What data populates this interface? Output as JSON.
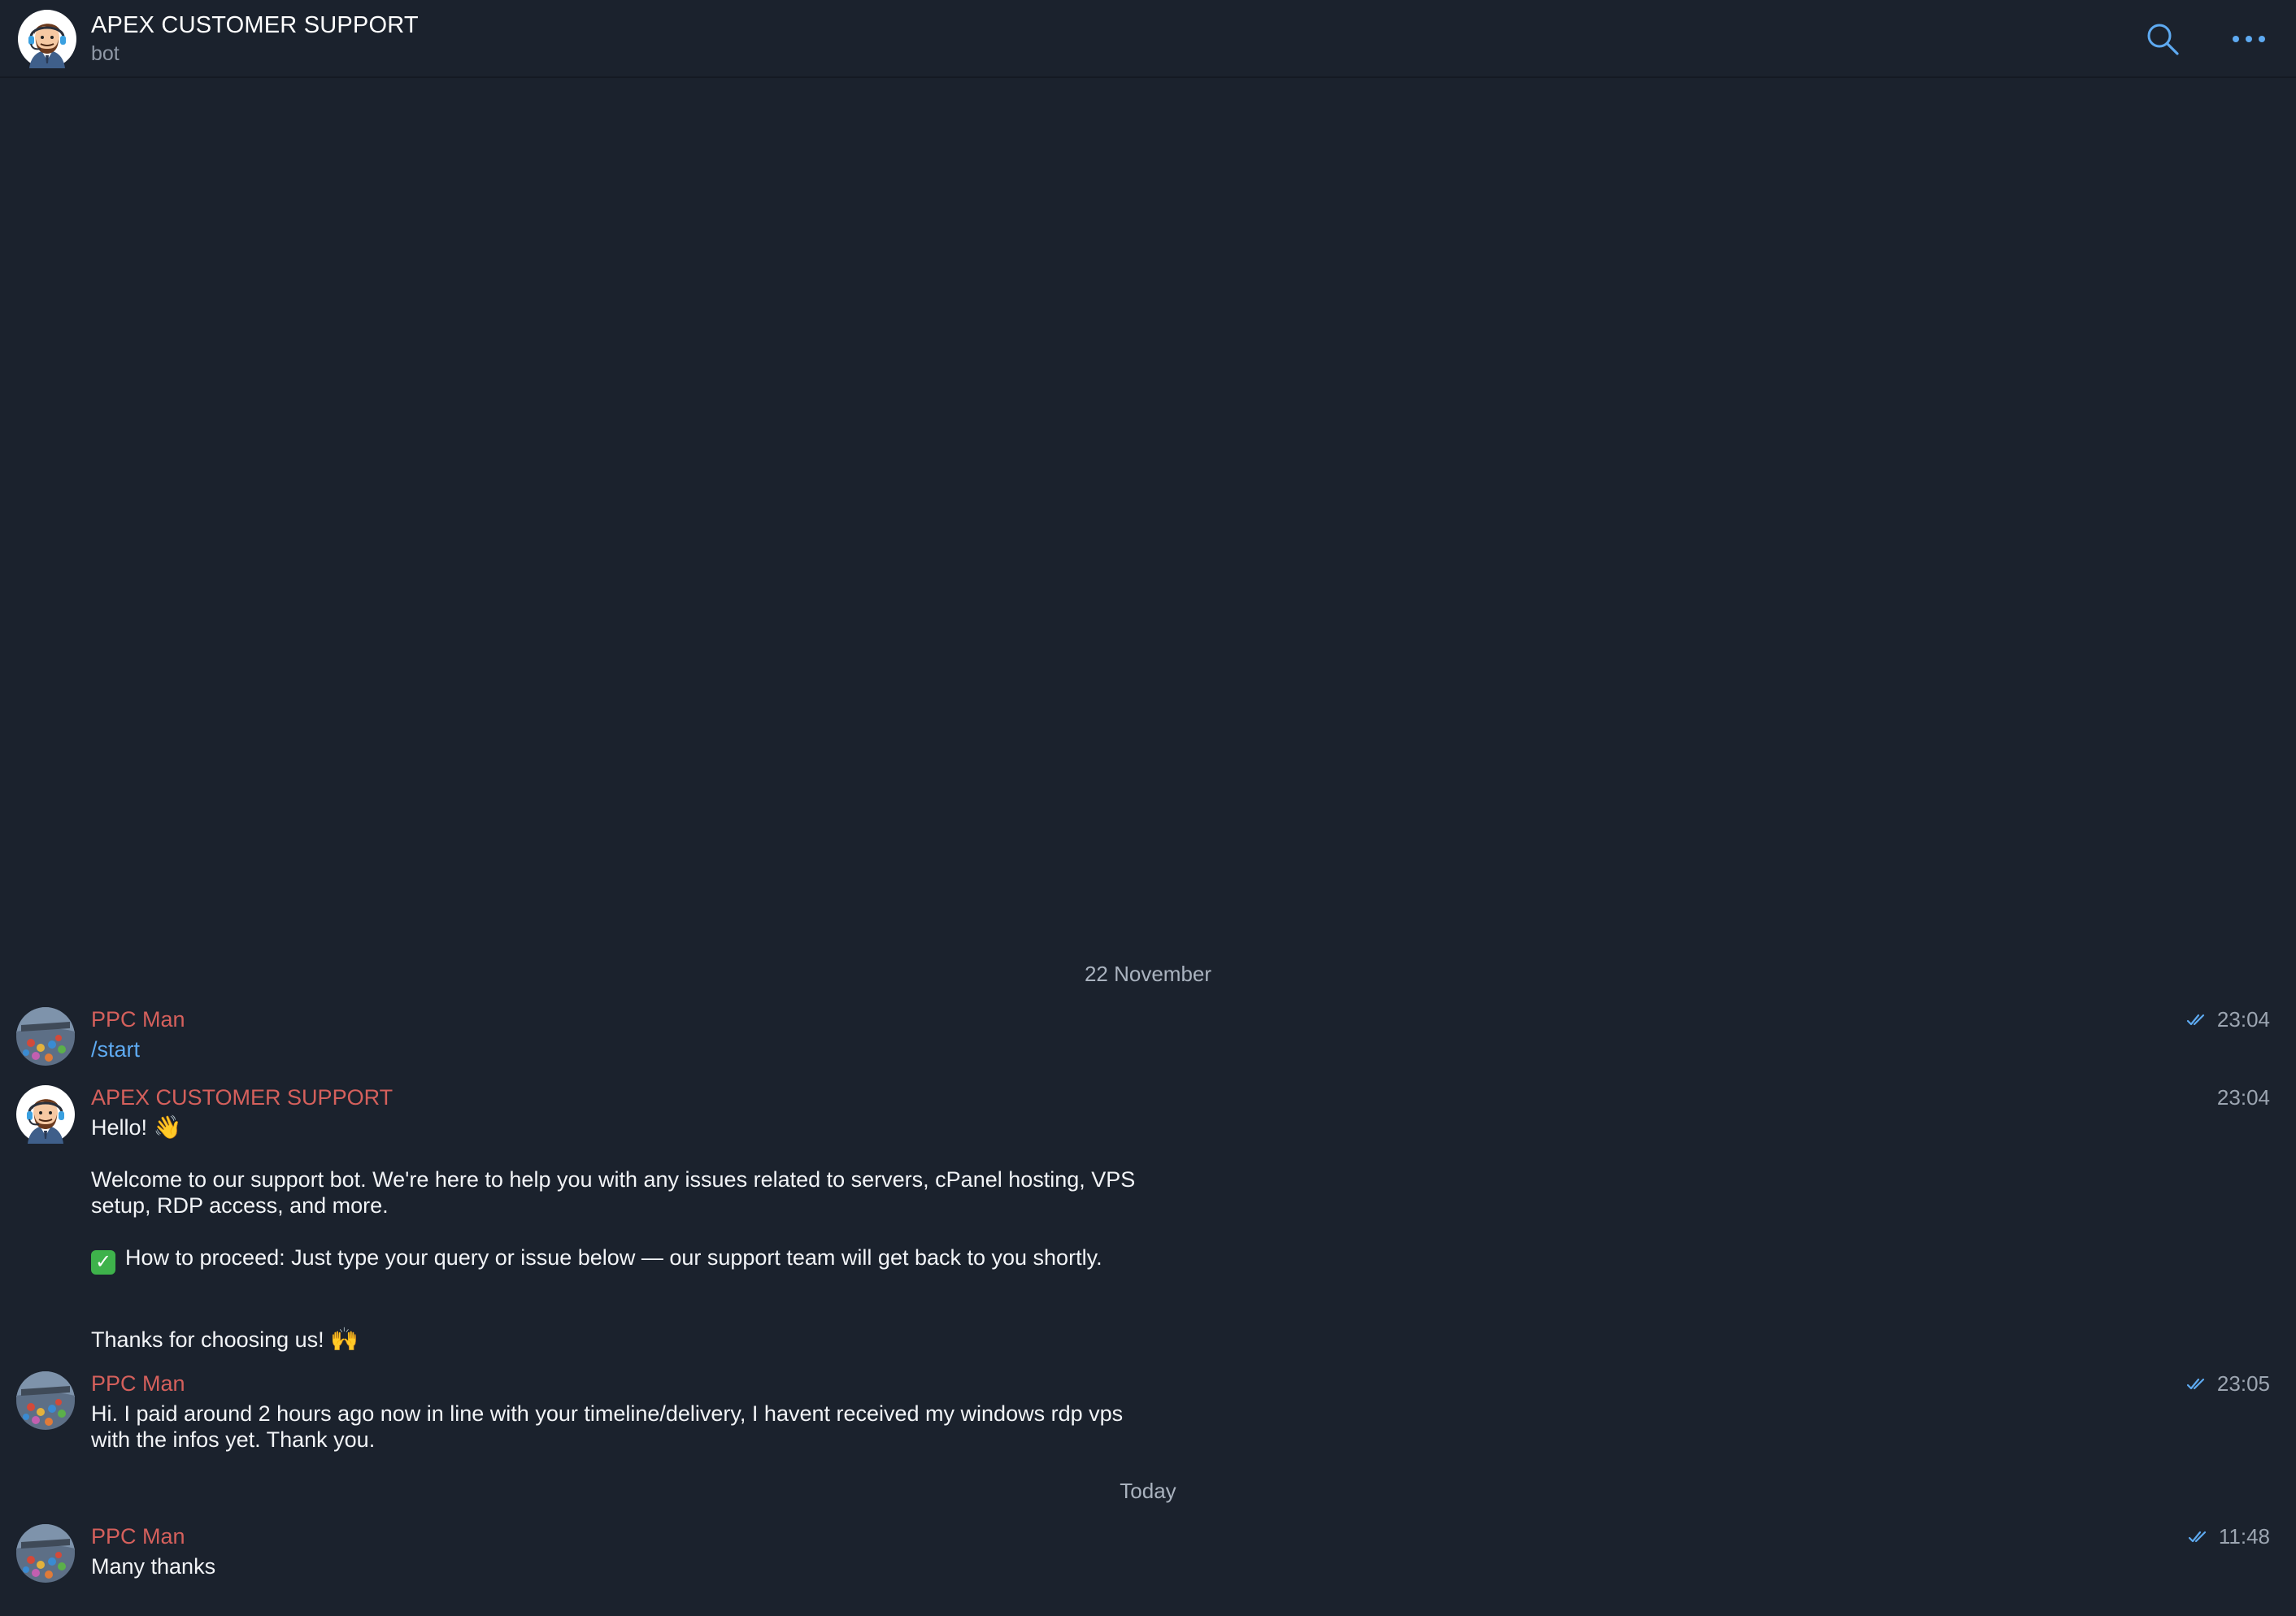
{
  "header": {
    "title": "APEX CUSTOMER SUPPORT",
    "subtitle": "bot",
    "search_icon": "search-icon",
    "more_icon": "more-horizontal-icon"
  },
  "chat": {
    "date_separators": [
      "22 November",
      "Today"
    ],
    "messages": [
      {
        "sender": "PPC Man",
        "time": "23:04",
        "read": true,
        "text": "/start"
      },
      {
        "sender": "APEX CUSTOMER SUPPORT",
        "time": "23:04",
        "read": false,
        "line1": "Hello!",
        "line1_emoji": "👋",
        "line2": "Welcome to our support bot. We're here to help you with any issues related to servers, cPanel hosting, VPS setup, RDP access, and more.",
        "line3_emoji": "✓",
        "line3": "How to proceed: Just type your query or issue below — our support team will get back to you shortly.",
        "line4": "Thanks for choosing us!",
        "line4_emoji": "🙌"
      },
      {
        "sender": "PPC Man",
        "time": "23:05",
        "read": true,
        "text": "Hi. I paid around 2 hours ago now in line with your timeline/delivery, I havent received my windows rdp vps with the infos yet. Thank you."
      },
      {
        "sender": "PPC Man",
        "time": "11:48",
        "read": true,
        "text": "Many thanks"
      }
    ]
  },
  "colors": {
    "background": "#1b222d",
    "sender_name": "#d5605c",
    "accent_blue": "#5eaaf1",
    "read_check": "#5eaaf1"
  }
}
